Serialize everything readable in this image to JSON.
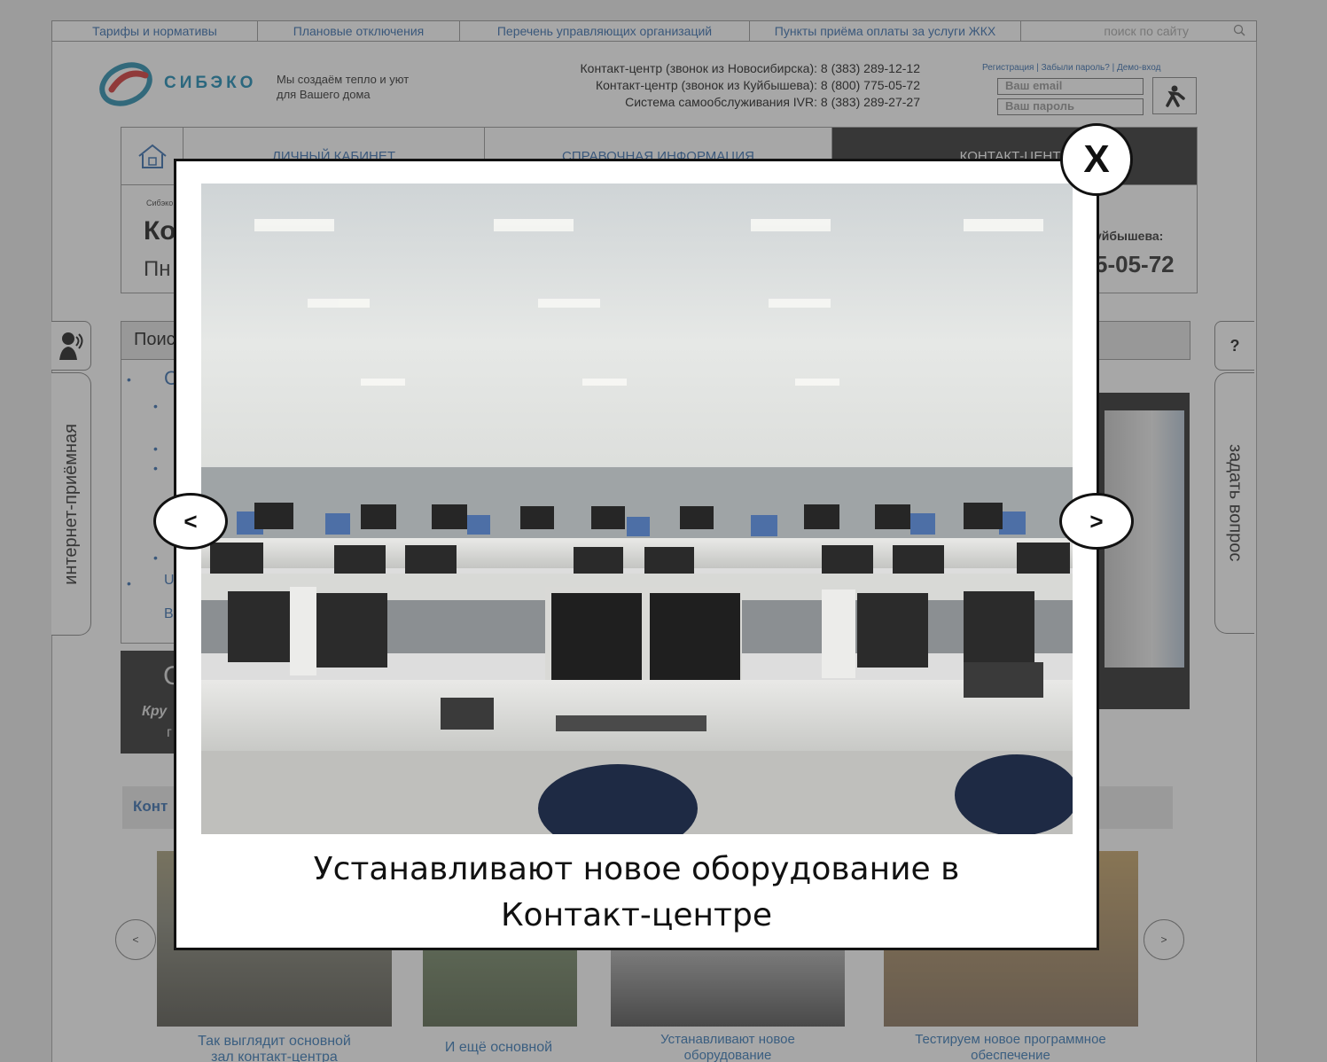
{
  "topnav": {
    "items": [
      "Тарифы и нормативы",
      "Плановые отключения",
      "Перечень управляющих организаций",
      "Пункты приёма оплаты за услуги ЖКХ"
    ],
    "search_placeholder": "поиск по сайту"
  },
  "header": {
    "logo_text": "СИБЭКО",
    "slogan_line1": "Мы создаём тепло и уют",
    "slogan_line2": "для Вашего дома",
    "contact_lines": [
      "Контакт-центр (звонок из Новосибирска): 8 (383) 289-12-12",
      "Контакт-центр (звонок из Куйбышева): 8 (800) 775-05-72",
      "Система самообслуживания IVR: 8 (383) 289-27-27"
    ],
    "auth_links": "Регистрация | Забыли пароль? | Демо-вход",
    "email_placeholder": "Ваш email",
    "password_placeholder": "Ваш пароль"
  },
  "mainnav": {
    "items": [
      "ЛИЧНЫЙ КАБИНЕТ",
      "СПРАВОЧНАЯ ИНФОРМАЦИЯ",
      "КОНТАКТ-ЦЕНТР"
    ]
  },
  "content": {
    "breadcrumb": "Сибэко",
    "title_fragment": "Ко",
    "subtitle_fragment": "Пн",
    "right_label_fragment": "уйбышева:",
    "right_phone_fragment": "5-05-72",
    "search_section_fragment": "Поис",
    "list_fragments": [
      "С",
      "U",
      "В"
    ],
    "dark_block_fragment1": "С",
    "dark_block_fragment2": "Кру",
    "dark_block_fragment3": "г",
    "section2_fragment": "Конт"
  },
  "side_tabs": {
    "left": "интернет-приёмная",
    "right": "задать вопрос",
    "right_icon_text": "?"
  },
  "gallery": {
    "captions": [
      {
        "line1": "Так выглядит основной",
        "line2": "зал контакт-центра"
      },
      {
        "line1": "И ещё основной",
        "line2": ""
      },
      {
        "line1": "Устанавливают новое",
        "line2": "оборудование"
      },
      {
        "line1": "Тестируем новое программное",
        "line2": "обеспечение"
      }
    ],
    "prev_label": "<",
    "next_label": ">"
  },
  "modal": {
    "caption_line1": "Устанавливают новое оборудование в",
    "caption_line2": "Контакт-центре",
    "close_label": "X",
    "prev_label": "<",
    "next_label": ">"
  },
  "colors": {
    "accent": "#3a6fb0",
    "logo": "#1d8bb5",
    "dark_panel": "#333333"
  }
}
